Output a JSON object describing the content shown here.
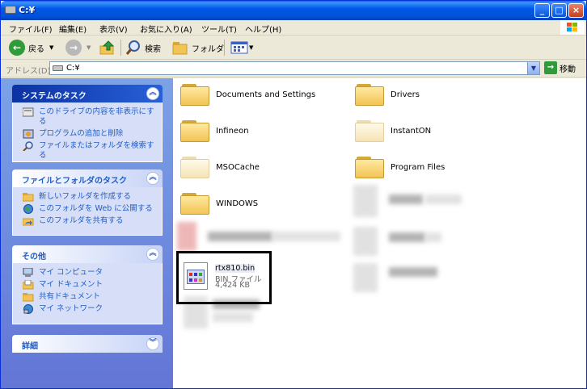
{
  "window": {
    "title": "C:¥"
  },
  "menu": [
    "ファイル(F)",
    "編集(E)",
    "表示(V)",
    "お気に入り(A)",
    "ツール(T)",
    "ヘルプ(H)"
  ],
  "toolbar": {
    "back_label": "戻る",
    "search_label": "検索",
    "folders_label": "フォルダ"
  },
  "address": {
    "label": "アドレス(D)",
    "value": "C:¥",
    "go_label": "移動"
  },
  "taskpane": {
    "system_tasks": {
      "title": "システムのタスク",
      "items": [
        "このドライブの内容を非表示にする",
        "プログラムの追加と削除",
        "ファイルまたはフォルダを検索する"
      ]
    },
    "file_tasks": {
      "title": "ファイルとフォルダのタスク",
      "items": [
        "新しいフォルダを作成する",
        "このフォルダを Web に公開する",
        "このフォルダを共有する"
      ]
    },
    "other_places": {
      "title": "その他",
      "items": [
        "マイ コンピュータ",
        "マイ ドキュメント",
        "共有ドキュメント",
        "マイ ネットワーク"
      ]
    },
    "details": {
      "title": "詳細"
    }
  },
  "folders": [
    "Documents and Settings",
    "Drivers",
    "Infineon",
    "InstantON",
    "MSOCache",
    "Program Files",
    "WINDOWS"
  ],
  "selected_file": {
    "name": "rtx810.bin",
    "type": "BIN ファイル",
    "size": "4,424 KB"
  },
  "colors": {
    "titlebar": "#0058e6",
    "taskpane": "#7ba2e7",
    "link": "#215dc6",
    "folder": "#f2c455"
  }
}
